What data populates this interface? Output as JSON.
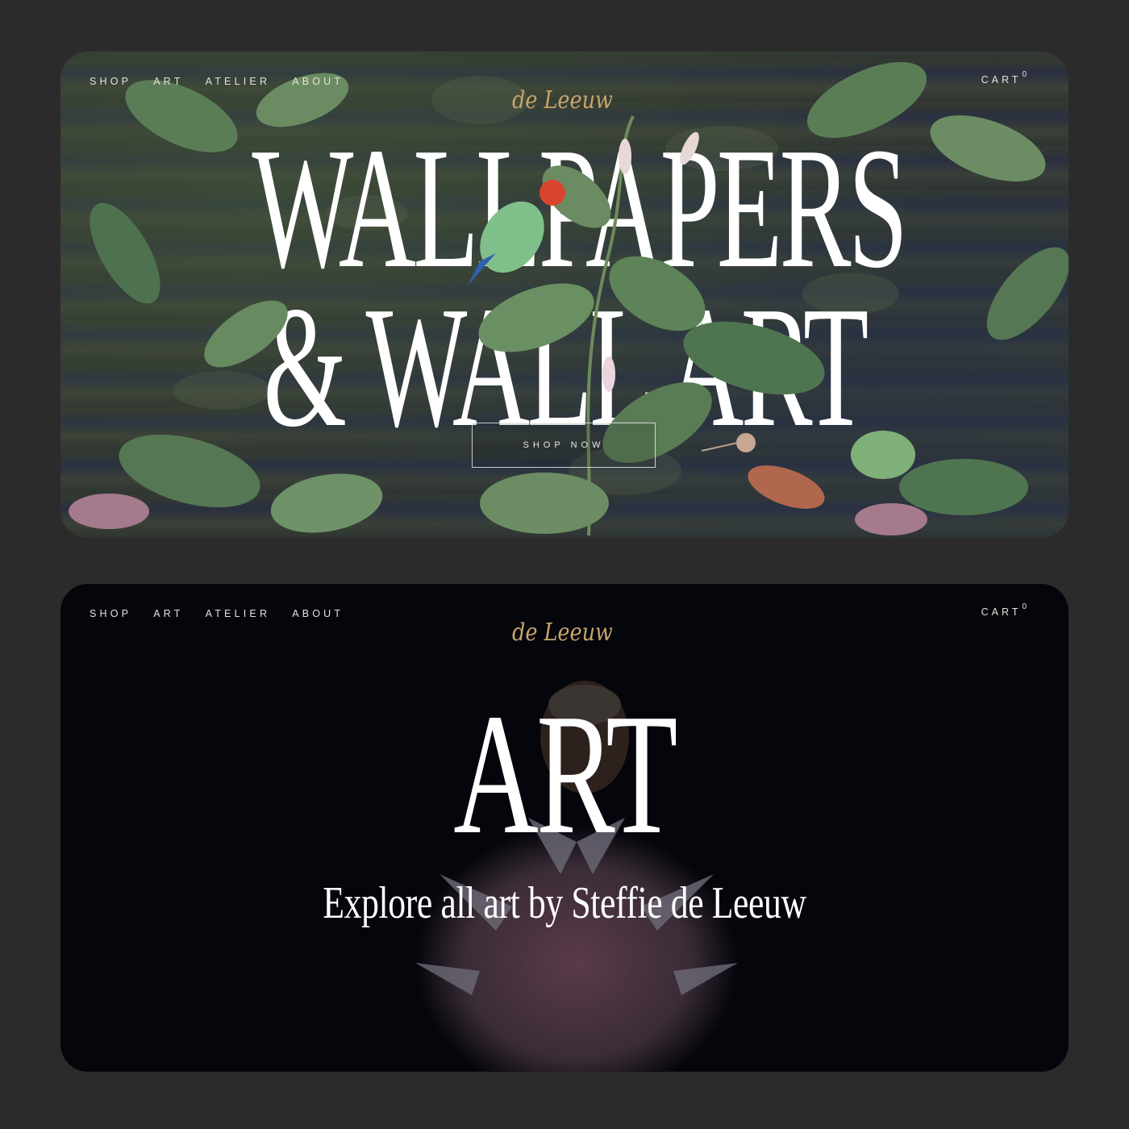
{
  "nav": {
    "items": [
      {
        "label": "SHOP"
      },
      {
        "label": "ART"
      },
      {
        "label": "ATELIER"
      },
      {
        "label": "ABOUT"
      }
    ],
    "cart_label": "CART",
    "cart_count": "0",
    "logo_text": "de Leeuw"
  },
  "hero": {
    "headline_line1": "WALLPAPERS",
    "headline_line2": "& WALL ART",
    "cta_label": "SHOP NOW"
  },
  "art_page": {
    "title": "ART",
    "subtitle": "Explore all art by Steffie de Leeuw"
  },
  "colors": {
    "page_background": "#2b2b2b",
    "hero_background": "#2f352f",
    "art_background": "#05050c",
    "logo_gold": "#c9a46a",
    "leaf_green": "#4f7550",
    "text_white": "#ffffff"
  }
}
